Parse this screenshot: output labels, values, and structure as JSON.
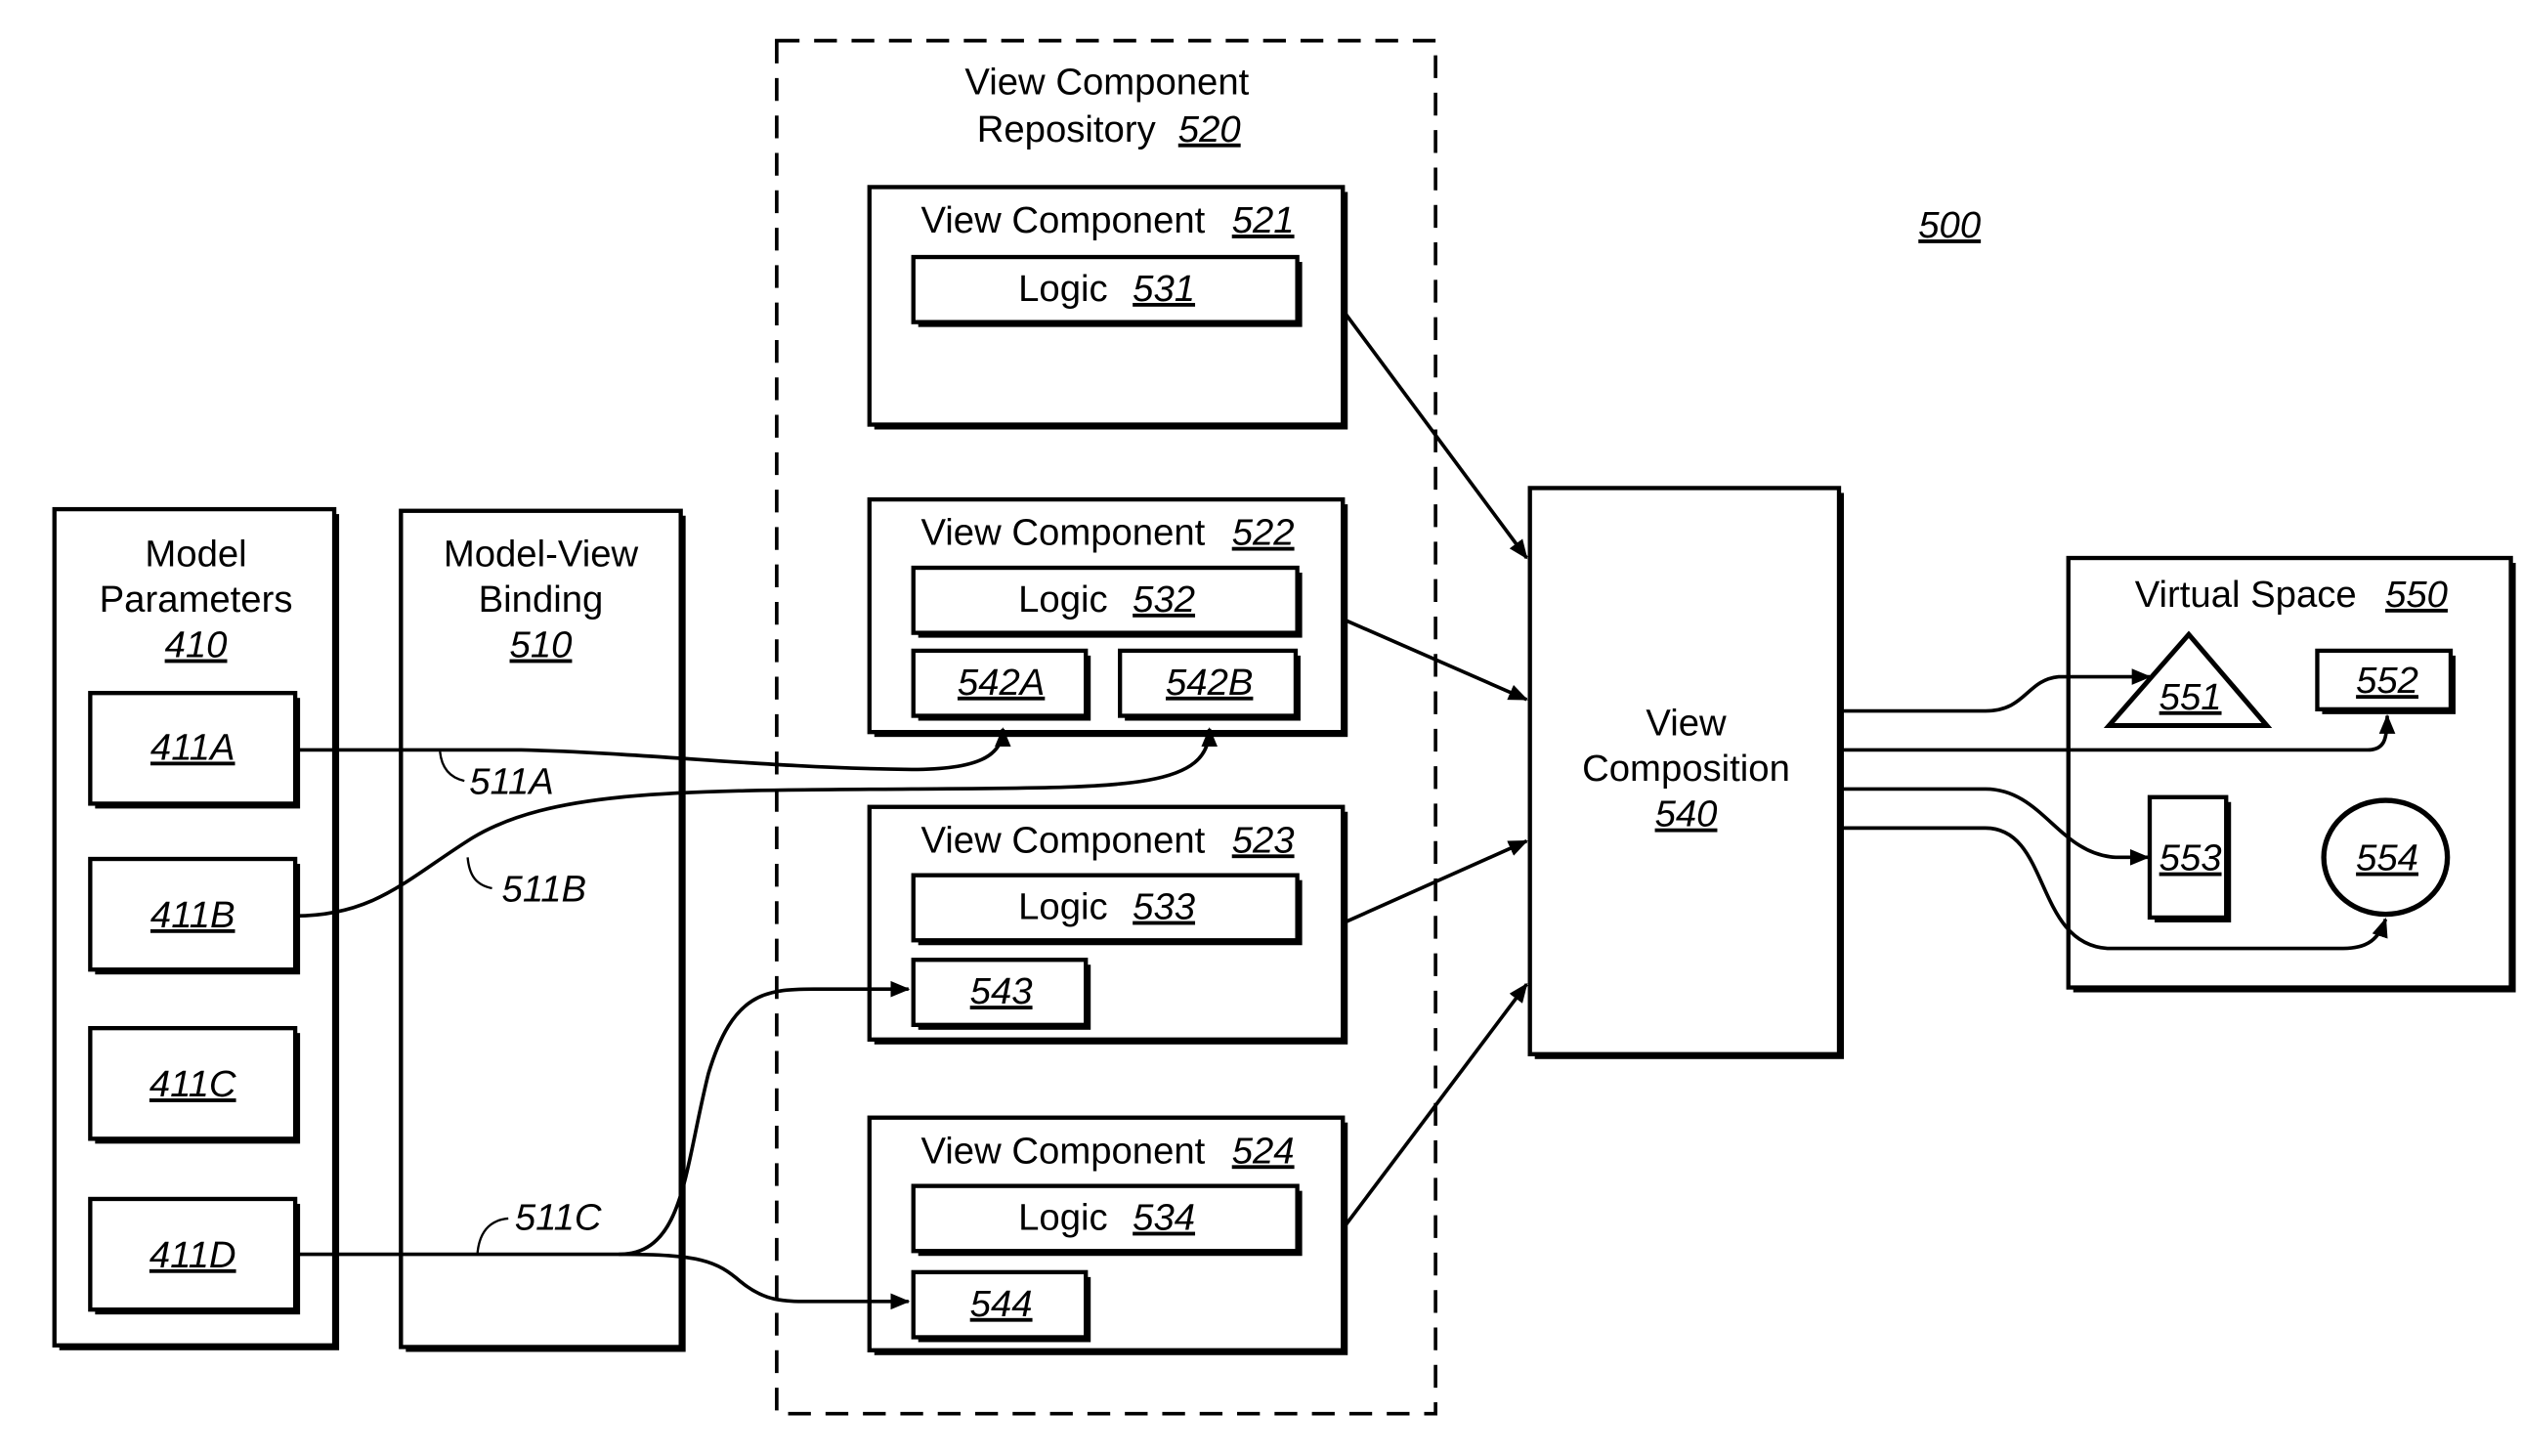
{
  "figure_ref": "500",
  "model_parameters": {
    "title_line1": "Model",
    "title_line2": "Parameters",
    "ref": "410",
    "items": [
      {
        "ref": "411A"
      },
      {
        "ref": "411B"
      },
      {
        "ref": "411C"
      },
      {
        "ref": "411D"
      }
    ]
  },
  "binding": {
    "title_line1": "Model-View",
    "title_line2": "Binding",
    "ref": "510",
    "links": [
      {
        "ref": "511A"
      },
      {
        "ref": "511B"
      },
      {
        "ref": "511C"
      }
    ]
  },
  "repository": {
    "title_line1": "View Component",
    "title_line2": "Repository",
    "ref": "520",
    "components": [
      {
        "label": "View Component",
        "ref": "521",
        "logic_label": "Logic",
        "logic_ref": "531",
        "slots": []
      },
      {
        "label": "View Component",
        "ref": "522",
        "logic_label": "Logic",
        "logic_ref": "532",
        "slots": [
          "542A",
          "542B"
        ]
      },
      {
        "label": "View Component",
        "ref": "523",
        "logic_label": "Logic",
        "logic_ref": "533",
        "slots": [
          "543"
        ]
      },
      {
        "label": "View Component",
        "ref": "524",
        "logic_label": "Logic",
        "logic_ref": "534",
        "slots": [
          "544"
        ]
      }
    ]
  },
  "composition": {
    "title_line1": "View",
    "title_line2": "Composition",
    "ref": "540"
  },
  "virtual_space": {
    "title": "Virtual Space",
    "ref": "550",
    "objects": [
      {
        "shape": "triangle",
        "ref": "551"
      },
      {
        "shape": "rectangle",
        "ref": "552"
      },
      {
        "shape": "tall-rectangle",
        "ref": "553"
      },
      {
        "shape": "circle",
        "ref": "554"
      }
    ]
  }
}
